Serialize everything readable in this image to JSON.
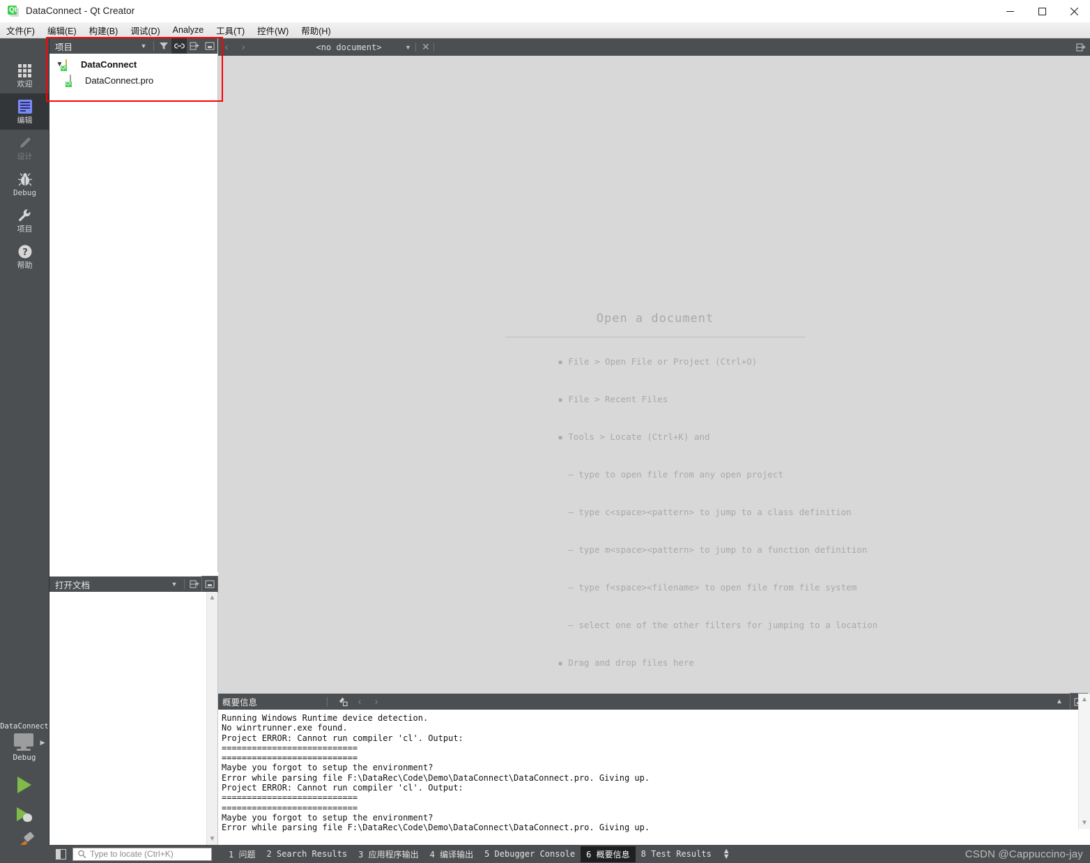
{
  "window": {
    "title": "DataConnect - Qt Creator",
    "app_icon": "qt-logo-icon",
    "minimize": "minimize-icon",
    "maximize": "maximize-icon",
    "close": "close-icon"
  },
  "menubar": {
    "items": [
      {
        "label": "文件(F)"
      },
      {
        "label": "编辑(E)"
      },
      {
        "label": "构建(B)"
      },
      {
        "label": "调试(D)"
      },
      {
        "label": "Analyze"
      },
      {
        "label": "工具(T)"
      },
      {
        "label": "控件(W)"
      },
      {
        "label": "帮助(H)"
      }
    ]
  },
  "modebar": {
    "items": [
      {
        "label": "欢迎",
        "icon": "grid-icon",
        "state": "normal"
      },
      {
        "label": "编辑",
        "icon": "document-icon",
        "state": "selected"
      },
      {
        "label": "设计",
        "icon": "pencil-icon",
        "state": "disabled"
      },
      {
        "label": "Debug",
        "icon": "bug-icon",
        "state": "normal"
      },
      {
        "label": "项目",
        "icon": "wrench-icon",
        "state": "normal"
      },
      {
        "label": "帮助",
        "icon": "question-circle-icon",
        "state": "normal"
      }
    ]
  },
  "kitbar": {
    "project": "DataConnect",
    "target": "Debug",
    "monitor_icon": "desktop-monitor-icon",
    "run_icon": "run-play-icon",
    "debug_icon": "debug-play-bug-icon",
    "build_icon": "hammer-build-icon"
  },
  "projects_dock": {
    "title": "项目",
    "tools": [
      {
        "name": "filter-dropdown-icon",
        "glyph": "▾"
      },
      {
        "name": "filter-icon",
        "glyph": "filter"
      },
      {
        "name": "link-sync-icon",
        "glyph": "link",
        "active": true
      },
      {
        "name": "split-add-icon",
        "glyph": "split"
      },
      {
        "name": "collapse-dock-icon",
        "glyph": "dock"
      }
    ],
    "tree": [
      {
        "label": "DataConnect",
        "icon": "qt-project-folder-icon",
        "level": 0,
        "bold": true,
        "expanded": true
      },
      {
        "label": "DataConnect.pro",
        "icon": "qt-pro-file-icon",
        "level": 1,
        "bold": false
      }
    ]
  },
  "documents_dock": {
    "title": "打开文档",
    "tools": [
      {
        "name": "dropdown-icon",
        "glyph": "▾"
      },
      {
        "name": "split-add-icon",
        "glyph": "split"
      },
      {
        "name": "collapse-dock-icon",
        "glyph": "dock"
      }
    ],
    "items": []
  },
  "editor": {
    "nav_back": "nav-back-icon",
    "nav_forward": "nav-forward-icon",
    "document_selector": "<no document>",
    "selector_arrow": "chevron-down-icon",
    "close_document": "close-icon",
    "split_editor": "split-editor-icon",
    "placeholder": {
      "title": "Open a document",
      "lines": [
        {
          "marker": "▪",
          "text": "File > Open File or Project (Ctrl+O)",
          "indent": 0
        },
        {
          "marker": "▪",
          "text": "File > Recent Files",
          "indent": 0
        },
        {
          "marker": "▪",
          "text": "Tools > Locate (Ctrl+K) and",
          "indent": 0
        },
        {
          "marker": "–",
          "text": "type to open file from any open project",
          "indent": 1
        },
        {
          "marker": "–",
          "text": "type c<space><pattern> to jump to a class definition",
          "indent": 1
        },
        {
          "marker": "–",
          "text": "type m<space><pattern> to jump to a function definition",
          "indent": 1
        },
        {
          "marker": "–",
          "text": "type f<space><filename> to open file from file system",
          "indent": 1
        },
        {
          "marker": "–",
          "text": "select one of the other filters for jumping to a location",
          "indent": 1
        },
        {
          "marker": "▪",
          "text": "Drag and drop files here",
          "indent": 0
        }
      ]
    }
  },
  "output_pane": {
    "title": "概要信息",
    "clear_icon": "clear-broom-icon",
    "prev_icon": "prev-issue-icon",
    "next_icon": "next-issue-icon",
    "collapse_icon": "chevron-up-icon",
    "maximize_icon": "maximize-pane-icon",
    "text": "Running Windows Runtime device detection.\nNo winrtrunner.exe found.\nProject ERROR: Cannot run compiler 'cl'. Output:\n===========================\n===========================\nMaybe you forgot to setup the environment?\nError while parsing file F:\\DataRec\\Code\\Demo\\DataConnect\\DataConnect.pro. Giving up.\nProject ERROR: Cannot run compiler 'cl'. Output:\n===========================\n===========================\nMaybe you forgot to setup the environment?\nError while parsing file F:\\DataRec\\Code\\Demo\\DataConnect\\DataConnect.pro. Giving up."
  },
  "statusbar": {
    "sidebar_toggle": "sidebar-toggle-icon",
    "locator_icon": "search-icon",
    "locator_placeholder": "Type to locate (Ctrl+K)",
    "locator_value": "",
    "tabs": [
      {
        "number": "1",
        "label": "问题",
        "selected": false
      },
      {
        "number": "2",
        "label": "Search Results",
        "selected": false
      },
      {
        "number": "3",
        "label": "应用程序输出",
        "selected": false
      },
      {
        "number": "4",
        "label": "编译输出",
        "selected": false
      },
      {
        "number": "5",
        "label": "Debugger Console",
        "selected": false
      },
      {
        "number": "6",
        "label": "概要信息",
        "selected": true
      },
      {
        "number": "8",
        "label": "Test Results",
        "selected": false
      }
    ],
    "updown_icon": "up-down-arrows-icon"
  },
  "watermark": {
    "text": "CSDN @Cappuccino-jay"
  },
  "annotation": {
    "color": "#ff0000",
    "target": "projects-dock-highlight"
  }
}
